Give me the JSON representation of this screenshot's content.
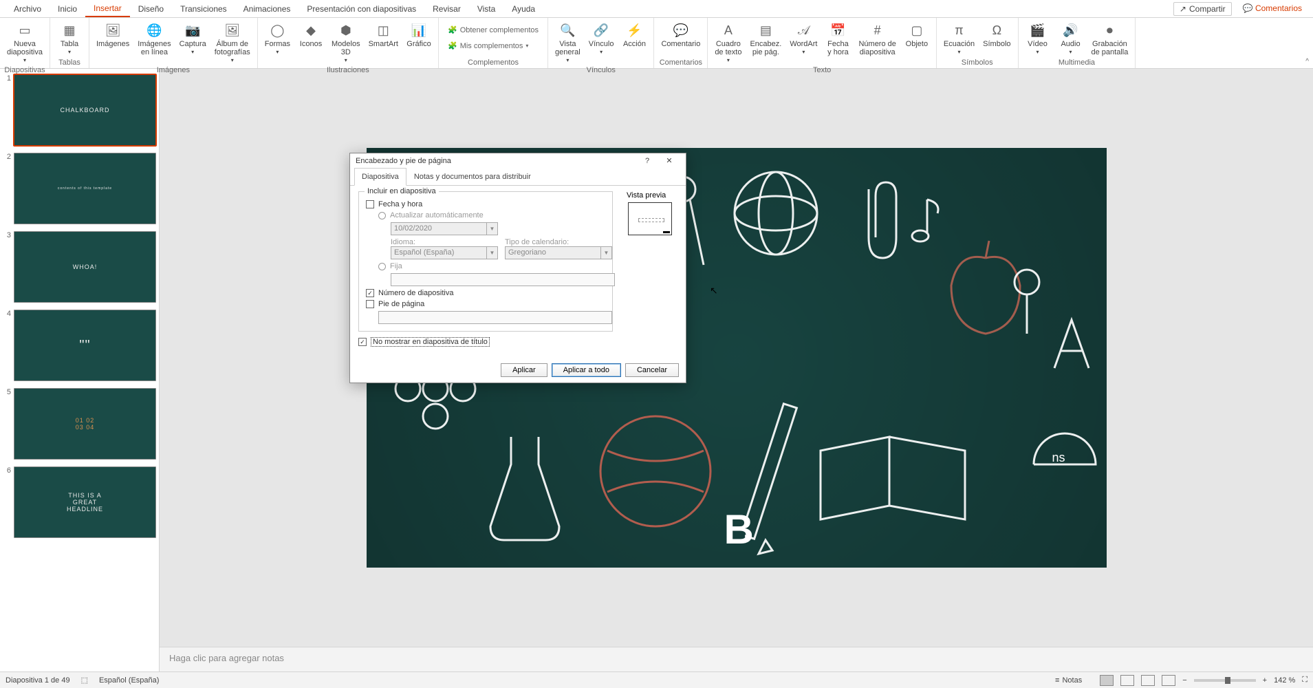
{
  "tabs": {
    "items": [
      "Archivo",
      "Inicio",
      "Insertar",
      "Diseño",
      "Transiciones",
      "Animaciones",
      "Presentación con diapositivas",
      "Revisar",
      "Vista",
      "Ayuda"
    ],
    "active_index": 2,
    "share": "Compartir",
    "comments": "Comentarios"
  },
  "ribbon": {
    "groups": {
      "diapositivas": {
        "label": "Diapositivas",
        "nueva": "Nueva\ndiapositiva"
      },
      "tablas": {
        "label": "Tablas",
        "tabla": "Tabla"
      },
      "imagenes": {
        "label": "Imágenes",
        "imagenes": "Imágenes",
        "en_linea": "Imágenes\nen línea",
        "captura": "Captura",
        "album": "Álbum de\nfotografías"
      },
      "ilustraciones": {
        "label": "Ilustraciones",
        "formas": "Formas",
        "iconos": "Iconos",
        "m3d": "Modelos\n3D",
        "smartart": "SmartArt",
        "grafico": "Gráfico"
      },
      "complementos": {
        "label": "Complementos",
        "obtener": "Obtener complementos",
        "mis": "Mis complementos"
      },
      "vinculos": {
        "label": "Vínculos",
        "vista": "Vista\ngeneral",
        "vinculo": "Vínculo",
        "accion": "Acción"
      },
      "comentarios": {
        "label": "Comentarios",
        "comentario": "Comentario"
      },
      "texto": {
        "label": "Texto",
        "cuadro": "Cuadro\nde texto",
        "encabez": "Encabez.\npie pág.",
        "wordart": "WordArt",
        "fecha": "Fecha\ny hora",
        "numero": "Número de\ndiapositiva",
        "objeto": "Objeto"
      },
      "simbolos": {
        "label": "Símbolos",
        "ecuacion": "Ecuación",
        "simbolo": "Símbolo"
      },
      "multimedia": {
        "label": "Multimedia",
        "video": "Vídeo",
        "audio": "Audio",
        "grabacion": "Grabación\nde pantalla"
      }
    }
  },
  "thumbs": [
    {
      "n": "1",
      "title": "CHALKBOARD"
    },
    {
      "n": "2",
      "title": "contents of this template"
    },
    {
      "n": "3",
      "title": "WHOA!"
    },
    {
      "n": "4",
      "title": "\"\""
    },
    {
      "n": "5",
      "title": "01  02\n03  04"
    },
    {
      "n": "6",
      "title": "THIS IS A\nGREAT\nHEADLINE"
    }
  ],
  "notes_placeholder": "Haga clic para agregar notas",
  "dialog": {
    "title": "Encabezado y pie de página",
    "tabs": {
      "slide": "Diapositiva",
      "handout": "Notas y documentos para distribuir"
    },
    "include_legend": "Incluir en diapositiva",
    "date_time": "Fecha y hora",
    "auto_update": "Actualizar automáticamente",
    "date_value": "10/02/2020",
    "idioma_label": "Idioma:",
    "idioma_value": "Español (España)",
    "calendar_label": "Tipo de calendario:",
    "calendar_value": "Gregoriano",
    "fixed": "Fija",
    "slide_number": "Número de diapositiva",
    "footer": "Pie de página",
    "dont_show_title": "No mostrar en diapositiva de título",
    "preview_label": "Vista previa",
    "apply": "Aplicar",
    "apply_all": "Aplicar a todo",
    "cancel": "Cancelar"
  },
  "status": {
    "slide_count": "Diapositiva 1 de 49",
    "lang": "Español (España)",
    "notas": "Notas",
    "zoom": "142 %"
  }
}
